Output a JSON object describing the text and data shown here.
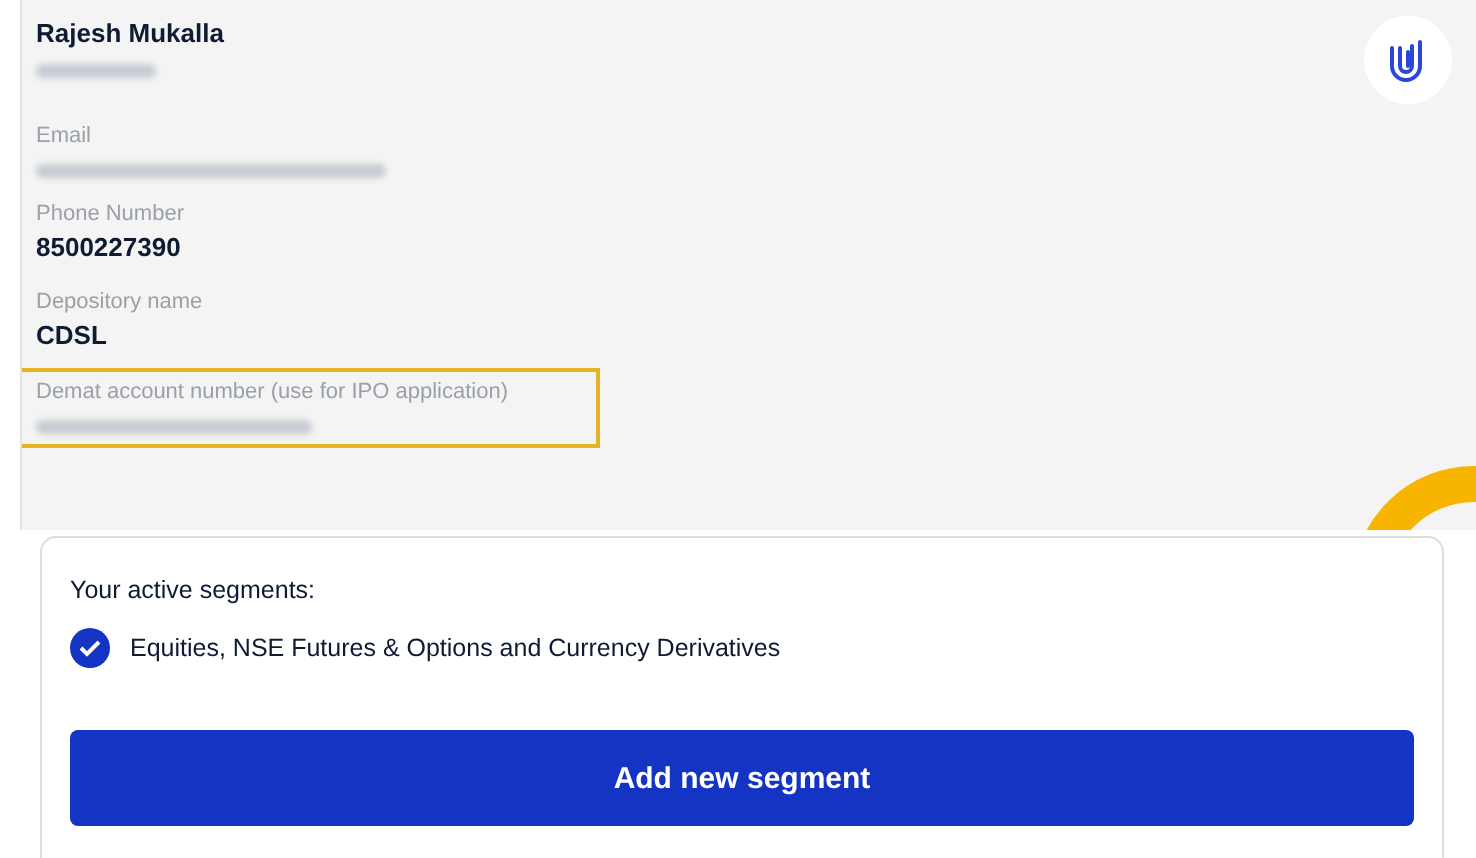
{
  "profile": {
    "name": "Rajesh Mukalla",
    "id_blurred": true
  },
  "fields": [
    {
      "label": "Email",
      "blurred": true,
      "highlighted": false
    },
    {
      "label": "Phone Number",
      "value": "8500227390",
      "blurred": false,
      "highlighted": false
    },
    {
      "label": "Depository name",
      "value": "CDSL",
      "blurred": false,
      "highlighted": false
    },
    {
      "label": "Demat account number (use for IPO application)",
      "blurred": true,
      "highlighted": true
    }
  ],
  "segments": {
    "title": "Your active segments:",
    "items": [
      {
        "label": "Equities, NSE Futures & Options and Currency Derivatives",
        "checked": true
      }
    ],
    "button": "Add new segment"
  }
}
